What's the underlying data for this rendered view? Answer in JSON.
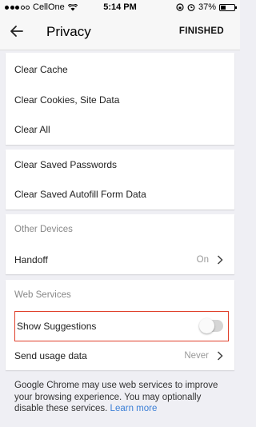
{
  "status_bar": {
    "carrier": "CellOne",
    "time": "5:14 PM",
    "battery_percent": "37%",
    "signal_bars": 3
  },
  "header": {
    "title": "Privacy",
    "action_label": "FINISHED",
    "back_icon": "arrow-left-icon"
  },
  "clear_browsing_data": {
    "items": [
      "Clear Cache",
      "Clear Cookies, Site Data",
      "Clear All"
    ]
  },
  "clear_saved_data": {
    "items": [
      "Clear Saved Passwords",
      "Clear Saved Autofill Form Data"
    ]
  },
  "other_devices": {
    "section_label": "Other Devices",
    "handoff_label": "Handoff",
    "handoff_value": "On"
  },
  "web_services": {
    "section_label": "Web Services",
    "show_suggestions_label": "Show Suggestions",
    "show_suggestions_enabled": false,
    "send_usage_label": "Send usage data",
    "send_usage_value": "Never"
  },
  "footer": {
    "text": "Google Chrome may use web services to improve your browsing experience. You may optionally disable these services.",
    "link_text": "Learn more"
  },
  "colors": {
    "highlight": "#e0402b",
    "link": "#3b7fd6",
    "background": "#efeff4"
  }
}
